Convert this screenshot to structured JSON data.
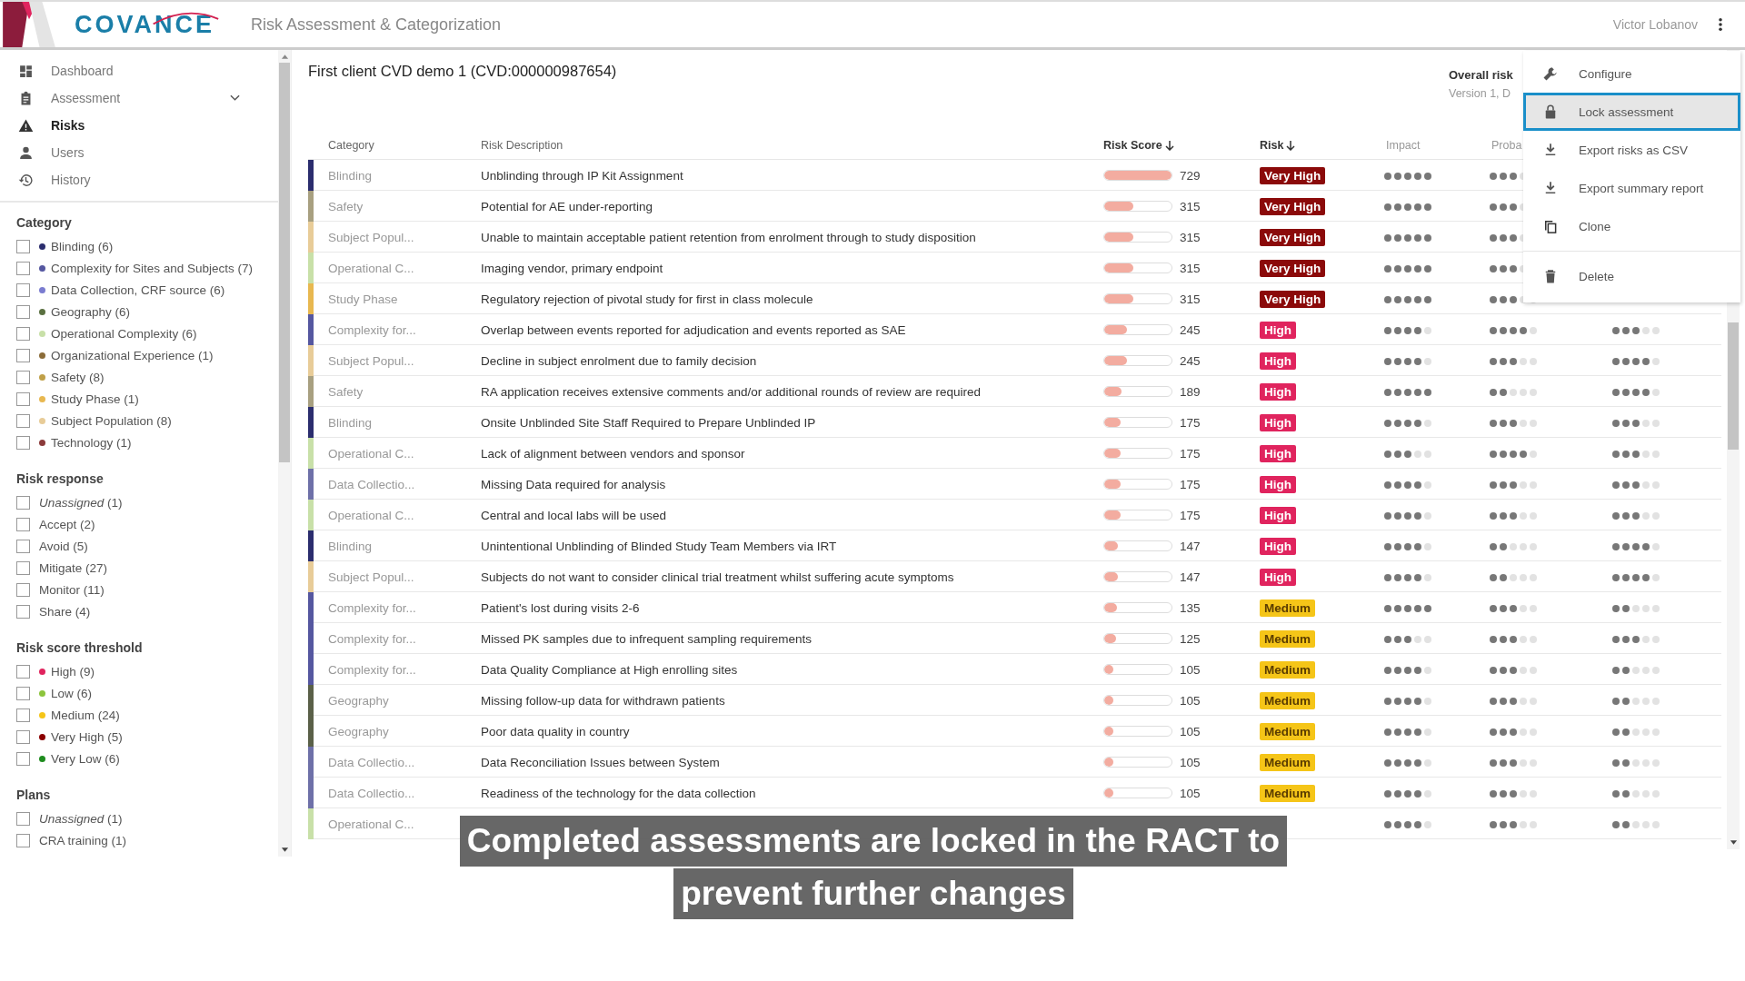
{
  "header": {
    "logo": "COVANCE",
    "title": "Risk Assessment & Categorization",
    "user": "Victor Lobanov"
  },
  "nav": [
    {
      "label": "Dashboard",
      "selected": false,
      "expandable": false
    },
    {
      "label": "Assessment",
      "selected": false,
      "expandable": true
    },
    {
      "label": "Risks",
      "selected": true,
      "expandable": false
    },
    {
      "label": "Users",
      "selected": false,
      "expandable": false
    },
    {
      "label": "History",
      "selected": false,
      "expandable": false
    }
  ],
  "filters": [
    {
      "title": "Category",
      "items": [
        {
          "label": "Blinding (6)",
          "color": "#2b2d6e",
          "checked": false
        },
        {
          "label": "Complexity for Sites and Subjects (7)",
          "color": "#5557a0",
          "checked": false
        },
        {
          "label": "Data Collection, CRF source (6)",
          "color": "#7a7cd0",
          "checked": false
        },
        {
          "label": "Geography (6)",
          "color": "#5a7040",
          "checked": false
        },
        {
          "label": "Operational Complexity (6)",
          "color": "#c8e0a8",
          "checked": false
        },
        {
          "label": "Organizational Experience (1)",
          "color": "#8b6c38",
          "checked": false
        },
        {
          "label": "Safety (8)",
          "color": "#c0a048",
          "checked": false
        },
        {
          "label": "Study Phase (1)",
          "color": "#e8b850",
          "checked": false
        },
        {
          "label": "Subject Population (8)",
          "color": "#e8cc98",
          "checked": false
        },
        {
          "label": "Technology (1)",
          "color": "#8b3a3a",
          "checked": false
        }
      ]
    },
    {
      "title": "Risk response",
      "items": [
        {
          "label": "*Unassigned* (1)",
          "checked": false
        },
        {
          "label": "Accept (2)",
          "checked": false
        },
        {
          "label": "Avoid (5)",
          "checked": false
        },
        {
          "label": "Mitigate (27)",
          "checked": false
        },
        {
          "label": "Monitor (11)",
          "checked": false
        },
        {
          "label": "Share (4)",
          "checked": false
        }
      ]
    },
    {
      "title": "Risk score threshold",
      "items": [
        {
          "label": "High (9)",
          "color": "#e0245e",
          "checked": false
        },
        {
          "label": "Low (6)",
          "color": "#8cc43c",
          "checked": false
        },
        {
          "label": "Medium (24)",
          "color": "#f5c518",
          "checked": false
        },
        {
          "label": "Very High (5)",
          "color": "#8b0000",
          "checked": false
        },
        {
          "label": "Very Low (6)",
          "color": "#1e8c1e",
          "checked": false
        }
      ]
    },
    {
      "title": "Plans",
      "items": [
        {
          "label": "*Unassigned* (1)",
          "checked": false
        },
        {
          "label": "CRA training (1)",
          "checked": false
        }
      ]
    }
  ],
  "assessment": {
    "title": "First client CVD demo 1 (CVD:000000987654)",
    "overall_label": "Overall risk",
    "version": "Version 1, D"
  },
  "columns": [
    {
      "label": "Category",
      "sorted": false
    },
    {
      "label": "Risk Description",
      "sorted": false
    },
    {
      "label": "Risk Score",
      "sorted": true
    },
    {
      "label": "Risk",
      "sorted": true
    },
    {
      "label": "Impact",
      "sorted": false
    },
    {
      "label": "Proba",
      "sorted": false
    }
  ],
  "rows": [
    {
      "category": "Blinding",
      "color": "#2b2d6e",
      "description": "Unblinding through IP Kit Assignment",
      "score": "729",
      "level": 1,
      "risk": {
        "label": "Very High",
        "kind": "very_high"
      },
      "impact": {
        "stars": 5
      },
      "probability": {
        "stars": 3
      }
    },
    {
      "category": "Safety",
      "color": "#a8a080",
      "description": "Potential for AE under-reporting",
      "score": "315",
      "level": 0.43,
      "risk": {
        "label": "Very High",
        "kind": "very_high"
      },
      "impact": {
        "stars": 5
      },
      "probability": {
        "stars": 3
      }
    },
    {
      "category": "Subject Popul...",
      "color": "#e8cc98",
      "description": "Unable to maintain acceptable patient retention from enrolment through to study disposition",
      "score": "315",
      "level": 0.43,
      "risk": {
        "label": "Very High",
        "kind": "very_high"
      },
      "impact": {
        "stars": 5
      },
      "probability": {
        "stars": 3
      }
    },
    {
      "category": "Operational C...",
      "color": "#c8e0a8",
      "description": "Imaging vendor, primary endpoint",
      "score": "315",
      "level": 0.43,
      "risk": {
        "label": "Very High",
        "kind": "very_high"
      },
      "impact": {
        "stars": 5
      },
      "probability": {
        "stars": 3
      }
    },
    {
      "category": "Study Phase",
      "color": "#e8b850",
      "description": "Regulatory rejection of pivotal study for first in class molecule",
      "score": "315",
      "level": 0.43,
      "risk": {
        "label": "Very High",
        "kind": "very_high"
      },
      "impact": {
        "stars": 5
      },
      "probability": {
        "stars": 3
      }
    },
    {
      "category": "Complexity for...",
      "color": "#5557a0",
      "description": "Overlap between events reported for adjudication and events reported as SAE",
      "score": "245",
      "level": 0.34,
      "risk": {
        "label": "High",
        "kind": "high"
      },
      "impact": {
        "stars": 4
      },
      "probability": {
        "stars": 4
      },
      "column_7": {
        "stars": 3
      }
    },
    {
      "category": "Subject Popul...",
      "color": "#e8cc98",
      "description": "Decline in subject enrolment due to family decision",
      "score": "245",
      "level": 0.34,
      "risk": {
        "label": "High",
        "kind": "high"
      },
      "impact": {
        "stars": 4
      },
      "probability": {
        "stars": 3
      },
      "column_7": {
        "stars": 4
      }
    },
    {
      "category": "Safety",
      "color": "#a8a080",
      "description": "RA application receives extensive comments and/or additional rounds of review are required",
      "score": "189",
      "level": 0.26,
      "risk": {
        "label": "High",
        "kind": "high"
      },
      "impact": {
        "stars": 5
      },
      "probability": {
        "stars": 2
      },
      "column_7": {
        "stars": 4
      }
    },
    {
      "category": "Blinding",
      "color": "#2b2d6e",
      "description": "Onsite Unblinded Site Staff Required to Prepare Unblinded IP",
      "score": "175",
      "level": 0.24,
      "risk": {
        "label": "High",
        "kind": "high"
      },
      "impact": {
        "stars": 4
      },
      "probability": {
        "stars": 3
      },
      "column_7": {
        "stars": 3
      }
    },
    {
      "category": "Operational C...",
      "color": "#c8e0a8",
      "description": "Lack of alignment between vendors and sponsor",
      "score": "175",
      "level": 0.24,
      "risk": {
        "label": "High",
        "kind": "high"
      },
      "impact": {
        "stars": 3
      },
      "probability": {
        "stars": 4
      },
      "column_7": {
        "stars": 3
      }
    },
    {
      "category": "Data Collectio...",
      "color": "#6e70a8",
      "description": "Missing Data required for analysis",
      "score": "175",
      "level": 0.24,
      "risk": {
        "label": "High",
        "kind": "high"
      },
      "impact": {
        "stars": 4
      },
      "probability": {
        "stars": 3
      },
      "column_7": {
        "stars": 3
      }
    },
    {
      "category": "Operational C...",
      "color": "#c8e0a8",
      "description": "Central and local labs will be used",
      "score": "175",
      "level": 0.24,
      "risk": {
        "label": "High",
        "kind": "high"
      },
      "impact": {
        "stars": 4
      },
      "probability": {
        "stars": 3
      },
      "column_7": {
        "stars": 3
      }
    },
    {
      "category": "Blinding",
      "color": "#2b2d6e",
      "description": "Unintentional Unblinding of Blinded Study Team Members via IRT",
      "score": "147",
      "level": 0.2,
      "risk": {
        "label": "High",
        "kind": "high"
      },
      "impact": {
        "stars": 4
      },
      "probability": {
        "stars": 2
      },
      "column_7": {
        "stars": 4
      }
    },
    {
      "category": "Subject Popul...",
      "color": "#e8cc98",
      "description": "Subjects do not want to consider clinical trial treatment whilst suffering acute symptoms",
      "score": "147",
      "level": 0.2,
      "risk": {
        "label": "High",
        "kind": "high"
      },
      "impact": {
        "stars": 4
      },
      "probability": {
        "stars": 2
      },
      "column_7": {
        "stars": 4
      }
    },
    {
      "category": "Complexity for...",
      "color": "#5557a0",
      "description": "Patient's lost during visits 2-6",
      "score": "135",
      "level": 0.19,
      "risk": {
        "label": "Medium",
        "kind": "medium"
      },
      "impact": {
        "stars": 5
      },
      "probability": {
        "stars": 3
      },
      "column_7": {
        "stars": 2
      }
    },
    {
      "category": "Complexity for...",
      "color": "#5557a0",
      "description": "Missed PK samples due to infrequent sampling requirements",
      "score": "125",
      "level": 0.17,
      "risk": {
        "label": "Medium",
        "kind": "medium"
      },
      "impact": {
        "stars": 3
      },
      "probability": {
        "stars": 3
      },
      "column_7": {
        "stars": 3
      }
    },
    {
      "category": "Complexity for...",
      "color": "#5557a0",
      "description": "Data Quality Compliance at High enrolling sites",
      "score": "105",
      "level": 0.14,
      "risk": {
        "label": "Medium",
        "kind": "medium"
      },
      "impact": {
        "stars": 4
      },
      "probability": {
        "stars": 3
      },
      "column_7": {
        "stars": 2
      }
    },
    {
      "category": "Geography",
      "color": "#5a6048",
      "description": "Missing follow-up data for withdrawn patients",
      "score": "105",
      "level": 0.14,
      "risk": {
        "label": "Medium",
        "kind": "medium"
      },
      "impact": {
        "stars": 4
      },
      "probability": {
        "stars": 3
      },
      "column_7": {
        "stars": 2
      }
    },
    {
      "category": "Geography",
      "color": "#5a6048",
      "description": "Poor data quality in country",
      "score": "105",
      "level": 0.14,
      "risk": {
        "label": "Medium",
        "kind": "medium"
      },
      "impact": {
        "stars": 4
      },
      "probability": {
        "stars": 3
      },
      "column_7": {
        "stars": 2
      }
    },
    {
      "category": "Data Collectio...",
      "color": "#6e70a8",
      "description": "Data Reconciliation Issues between System",
      "score": "105",
      "level": 0.14,
      "risk": {
        "label": "Medium",
        "kind": "medium"
      },
      "impact": {
        "stars": 4
      },
      "probability": {
        "stars": 3
      },
      "column_7": {
        "stars": 2
      }
    },
    {
      "category": "Data Collectio...",
      "color": "#6e70a8",
      "description": "Readiness of the technology for the data collection",
      "score": "105",
      "level": 0.14,
      "risk": {
        "label": "Medium",
        "kind": "medium"
      },
      "impact": {
        "stars": 4
      },
      "probability": {
        "stars": 3
      },
      "column_7": {
        "stars": 2
      }
    },
    {
      "category": "Operational C...",
      "color": "#c8e0a8",
      "impact": {
        "stars": 4
      },
      "probability": {
        "stars": 3
      },
      "column_7": {
        "stars": 2
      }
    }
  ],
  "menu": {
    "groups": [
      [
        {
          "label": "Configure",
          "selected": false
        },
        {
          "label": "Lock assessment",
          "selected": true
        },
        {
          "label": "Export risks as CSV",
          "selected": false
        },
        {
          "label": "Export summary report",
          "selected": false
        },
        {
          "label": "Clone",
          "selected": false
        }
      ],
      [
        {
          "label": "Delete",
          "selected": false
        }
      ]
    ]
  },
  "caption": {
    "lines": [
      "Completed assessments are locked in the RACT to",
      "prevent further changes"
    ]
  }
}
